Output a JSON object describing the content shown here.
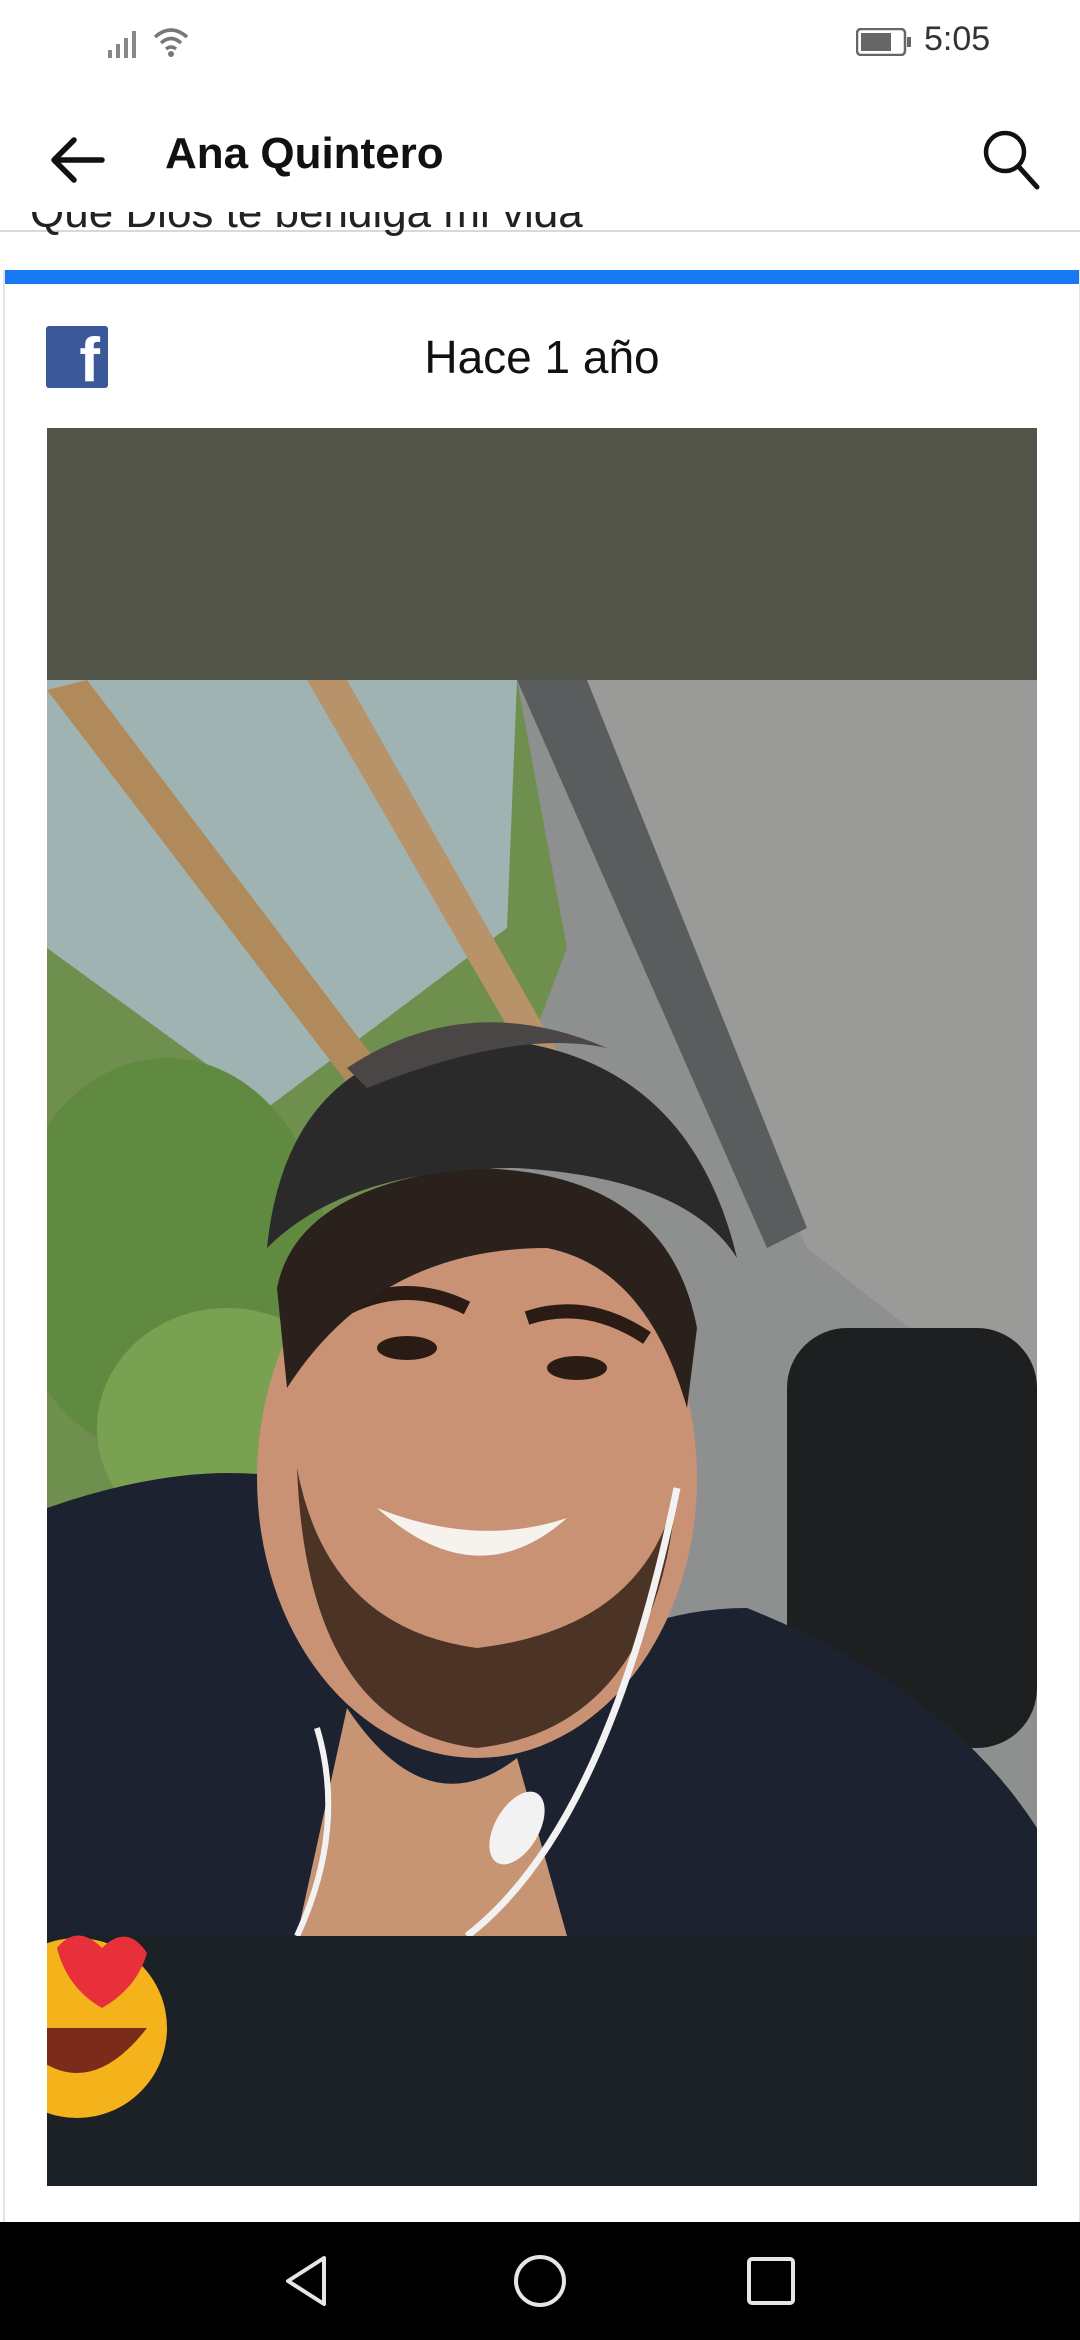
{
  "status_bar": {
    "time": "5:05"
  },
  "header": {
    "title": "Ana Quintero",
    "back_icon": "arrow-left-icon",
    "search_icon": "search-icon"
  },
  "feed": {
    "previous_post_text": "Que Dios te bendiga mi vida"
  },
  "memory_card": {
    "source_icon": "facebook-logo-icon",
    "date_label": "Hace 1 año",
    "accent_color": "#1877f2",
    "photo": "selfie-photo"
  },
  "nav_bar": {
    "back": "nav-back-icon",
    "home": "nav-home-icon",
    "recents": "nav-recents-icon"
  }
}
